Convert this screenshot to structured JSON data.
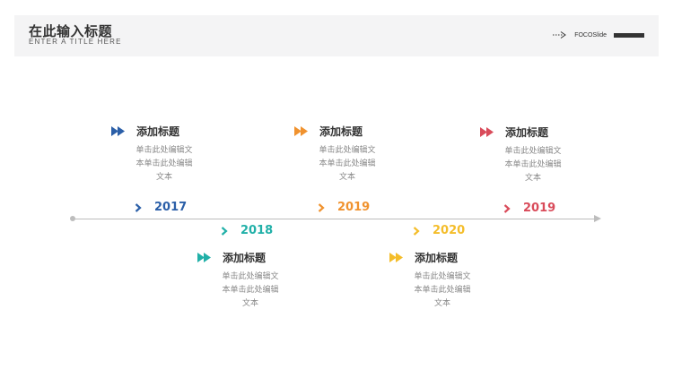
{
  "header": {
    "title": "在此输入标题",
    "subtitle": "ENTER A TITLE HERE",
    "brand": "FOCOSlide",
    "brand_icon": "dotted-arrow-icon"
  },
  "colors": {
    "blue": "#2b5fa8",
    "teal": "#21b0a8",
    "orange": "#f0922e",
    "yellow": "#f4bd2a",
    "red": "#d94b5a",
    "axis": "#bdbdbd"
  },
  "timeline": {
    "milestones": [
      {
        "year": "2017",
        "title": "添加标题",
        "body": "单击此处编辑文\n本单击此处编辑\n文本",
        "color": "#2b5fa8",
        "position": "above"
      },
      {
        "year": "2018",
        "title": "添加标题",
        "body": "单击此处编辑文\n本单击此处编辑\n文本",
        "color": "#21b0a8",
        "position": "below"
      },
      {
        "year": "2019",
        "title": "添加标题",
        "body": "单击此处编辑文\n本单击此处编辑\n文本",
        "color": "#f0922e",
        "position": "above"
      },
      {
        "year": "2020",
        "title": "添加标题",
        "body": "单击此处编辑文\n本单击此处编辑\n文本",
        "color": "#f4bd2a",
        "position": "below"
      },
      {
        "year": "2019",
        "title": "添加标题",
        "body": "单击此处编辑文\n本单击此处编辑\n文本",
        "color": "#d94b5a",
        "position": "above"
      }
    ]
  }
}
